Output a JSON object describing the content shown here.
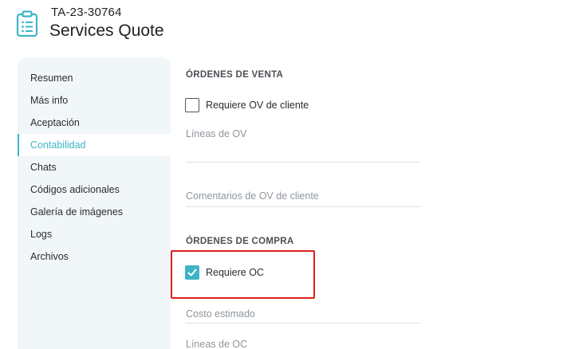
{
  "header": {
    "record_code": "TA-23-30764",
    "title": "Services Quote",
    "icon": "clipboard-list-icon"
  },
  "sidebar": {
    "items": [
      {
        "label": "Resumen",
        "active": false
      },
      {
        "label": "Más info",
        "active": false
      },
      {
        "label": "Aceptación",
        "active": false
      },
      {
        "label": "Contabilidad",
        "active": true
      },
      {
        "label": "Chats",
        "active": false
      },
      {
        "label": "Códigos adicionales",
        "active": false
      },
      {
        "label": "Galería de imágenes",
        "active": false
      },
      {
        "label": "Logs",
        "active": false
      },
      {
        "label": "Archivos",
        "active": false
      }
    ]
  },
  "sales_orders": {
    "section_title": "ÓRDENES DE VENTA",
    "requires_customer_so": {
      "label": "Requiere OV de cliente",
      "checked": false
    },
    "so_lines": {
      "label": "Líneas de OV",
      "value": ""
    },
    "customer_so_comments": {
      "label": "Comentarios de OV de cliente",
      "value": ""
    }
  },
  "purchase_orders": {
    "section_title": "ÓRDENES DE COMPRA",
    "requires_po": {
      "label": "Requiere OC",
      "checked": true
    },
    "estimated_cost": {
      "label": "Costo estimado",
      "value": ""
    },
    "po_lines": {
      "label": "Líneas de OC",
      "value": ""
    }
  },
  "colors": {
    "accent": "#3eb5c6",
    "highlight": "#e0201c",
    "sidebar_bg": "#f1f6f9"
  }
}
